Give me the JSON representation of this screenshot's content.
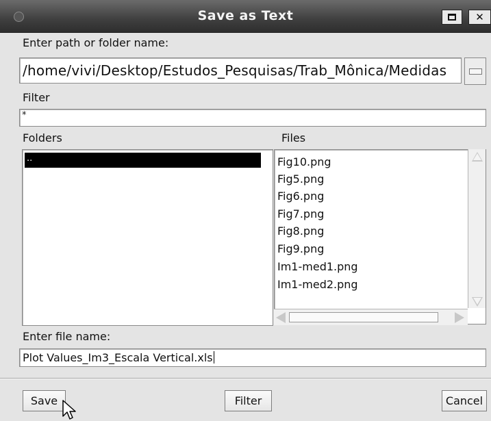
{
  "window": {
    "title": "Save as Text",
    "close_glyph": "✕",
    "icons": [
      "window-menu-icon",
      "maximize-icon",
      "close-icon"
    ]
  },
  "path": {
    "label": "Enter path or folder name:",
    "value": "/home/vivi/Desktop/Estudos_Pesquisas/Trab_Mônica/Medidas"
  },
  "filter": {
    "label": "Filter",
    "value": "*"
  },
  "folders": {
    "label": "Folders",
    "items": [
      ".."
    ]
  },
  "files": {
    "label": "Files",
    "items": [
      "Fig10.png",
      "Fig5.png",
      "Fig6.png",
      "Fig7.png",
      "Fig8.png",
      "Fig9.png",
      "Im1-med1.png",
      "Im1-med2.png"
    ]
  },
  "file_name": {
    "label": "Enter file name:",
    "value": "Plot Values_Im3_Escala Vertical.xls"
  },
  "buttons": {
    "save": "Save",
    "filter": "Filter",
    "cancel": "Cancel"
  },
  "colors": {
    "title_bar": "#3f3f3f",
    "selection": "#000000",
    "dialog_bg": "#e4e4e4"
  }
}
